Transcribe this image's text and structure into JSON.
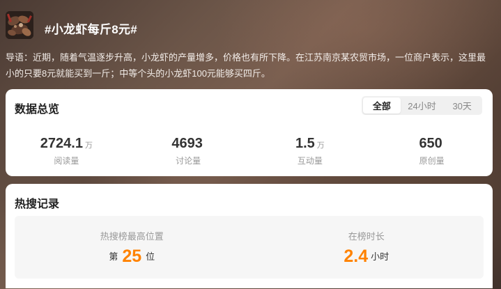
{
  "header": {
    "title": "#小龙虾每斤8元#",
    "intro": "导语：近期，随着气温逐步升高，小龙虾的产量增多，价格也有所下降。在江苏南京某农贸市场，一位商户表示，这里最小的只要8元就能买到一斤；中等个头的小龙虾100元能够买四斤。"
  },
  "overview": {
    "title": "数据总览",
    "tabs": [
      {
        "label": "全部",
        "active": true
      },
      {
        "label": "24小时",
        "active": false
      },
      {
        "label": "30天",
        "active": false
      }
    ],
    "stats": [
      {
        "value": "2724.1",
        "unit": "万",
        "label": "阅读量"
      },
      {
        "value": "4693",
        "unit": "",
        "label": "讨论量"
      },
      {
        "value": "1.5",
        "unit": "万",
        "label": "互动量"
      },
      {
        "value": "650",
        "unit": "",
        "label": "原创量"
      }
    ]
  },
  "hot": {
    "title": "热搜记录",
    "peak_label": "热搜榜最高位置",
    "peak_prefix": "第",
    "peak_value": "25",
    "peak_suffix": "位",
    "duration_label": "在榜时长",
    "duration_value": "2.4",
    "duration_unit": "小时"
  },
  "colors": {
    "accent": "#ff8200",
    "card_bg": "#ffffff",
    "inner_bg": "#f6f6f6"
  }
}
